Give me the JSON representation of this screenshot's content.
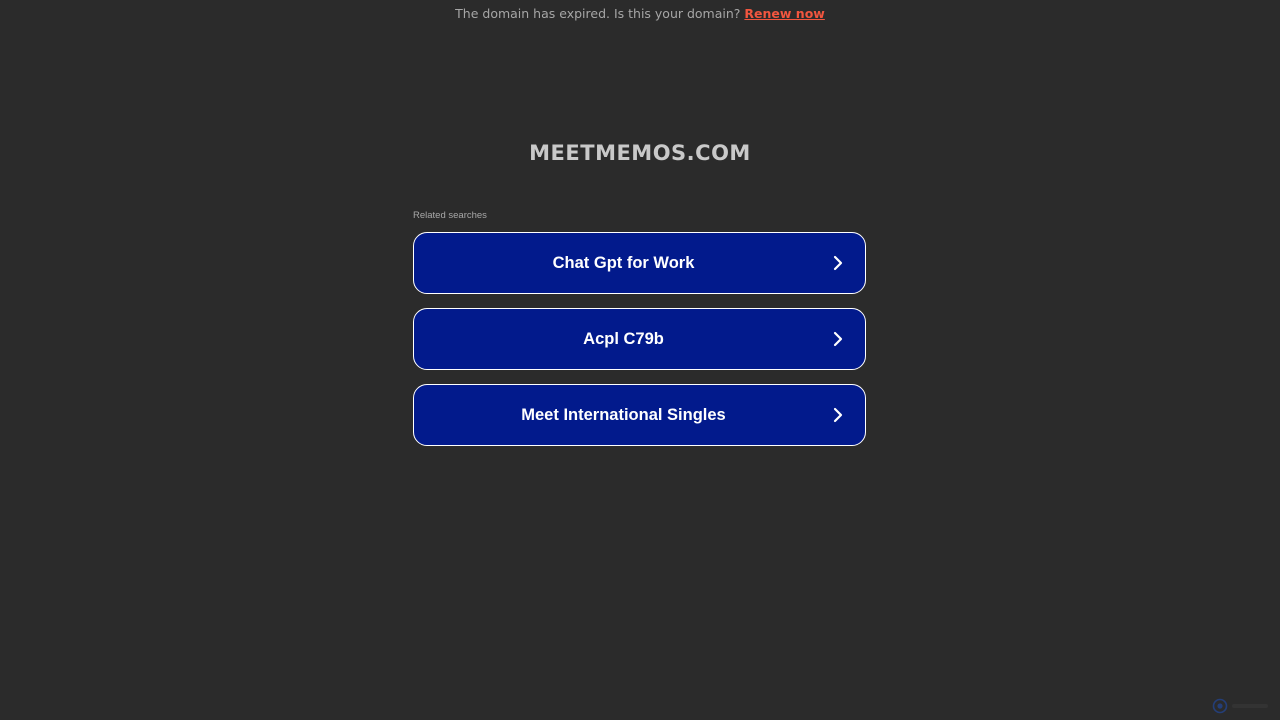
{
  "banner": {
    "message": "The domain has expired. Is this your domain?",
    "renew_label": "Renew now",
    "renew_color": "#f2563f"
  },
  "domain": {
    "title": "MEETMEMOS.COM"
  },
  "related_searches": {
    "heading": "Related searches",
    "items": [
      {
        "label": "Chat Gpt for Work",
        "icon": "chevron-right-icon"
      },
      {
        "label": "Acpl C79b",
        "icon": "chevron-right-icon"
      },
      {
        "label": "Meet International Singles",
        "icon": "chevron-right-icon"
      }
    ],
    "button_color": "#021a8c"
  },
  "footer": {
    "badge_icon": "privacy-badge-icon"
  }
}
